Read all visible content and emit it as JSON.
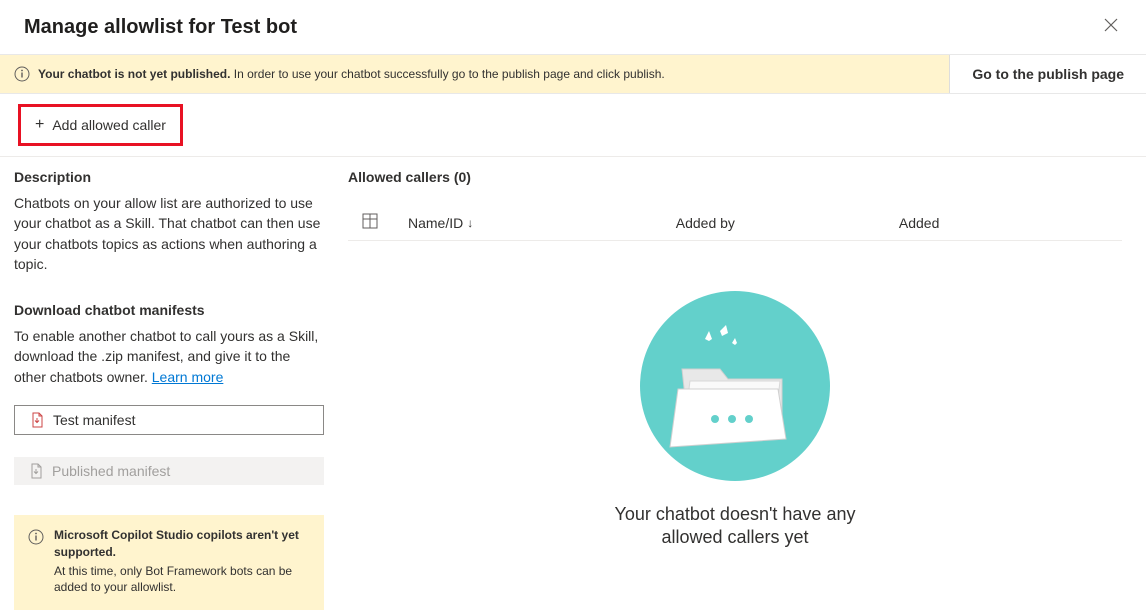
{
  "header": {
    "title": "Manage allowlist for Test bot"
  },
  "notice": {
    "bold": "Your chatbot is not yet published.",
    "rest": " In order to use your chatbot successfully go to the publish page and click publish.",
    "action": "Go to the publish page"
  },
  "toolbar": {
    "add_caller": "Add allowed caller"
  },
  "left": {
    "description_heading": "Description",
    "description_body": "Chatbots on your allow list are authorized to use your chatbot as a Skill. That chatbot can then use your chatbots topics as actions when authoring a topic.",
    "download_heading": "Download chatbot manifests",
    "download_body": "To enable another chatbot to call yours as a Skill, download the .zip manifest, and give it to the other chatbots owner. ",
    "learn_more": "Learn more",
    "test_manifest": "Test manifest",
    "published_manifest": "Published manifest",
    "warning_title": "Microsoft Copilot Studio copilots aren't yet supported.",
    "warning_body": "At this time, only Bot Framework bots can be added to your allowlist."
  },
  "right": {
    "allowed_callers_heading": "Allowed callers (0)",
    "columns": {
      "name": "Name/ID",
      "added_by": "Added by",
      "added": "Added"
    },
    "empty_message": "Your chatbot doesn't have any allowed callers yet"
  }
}
